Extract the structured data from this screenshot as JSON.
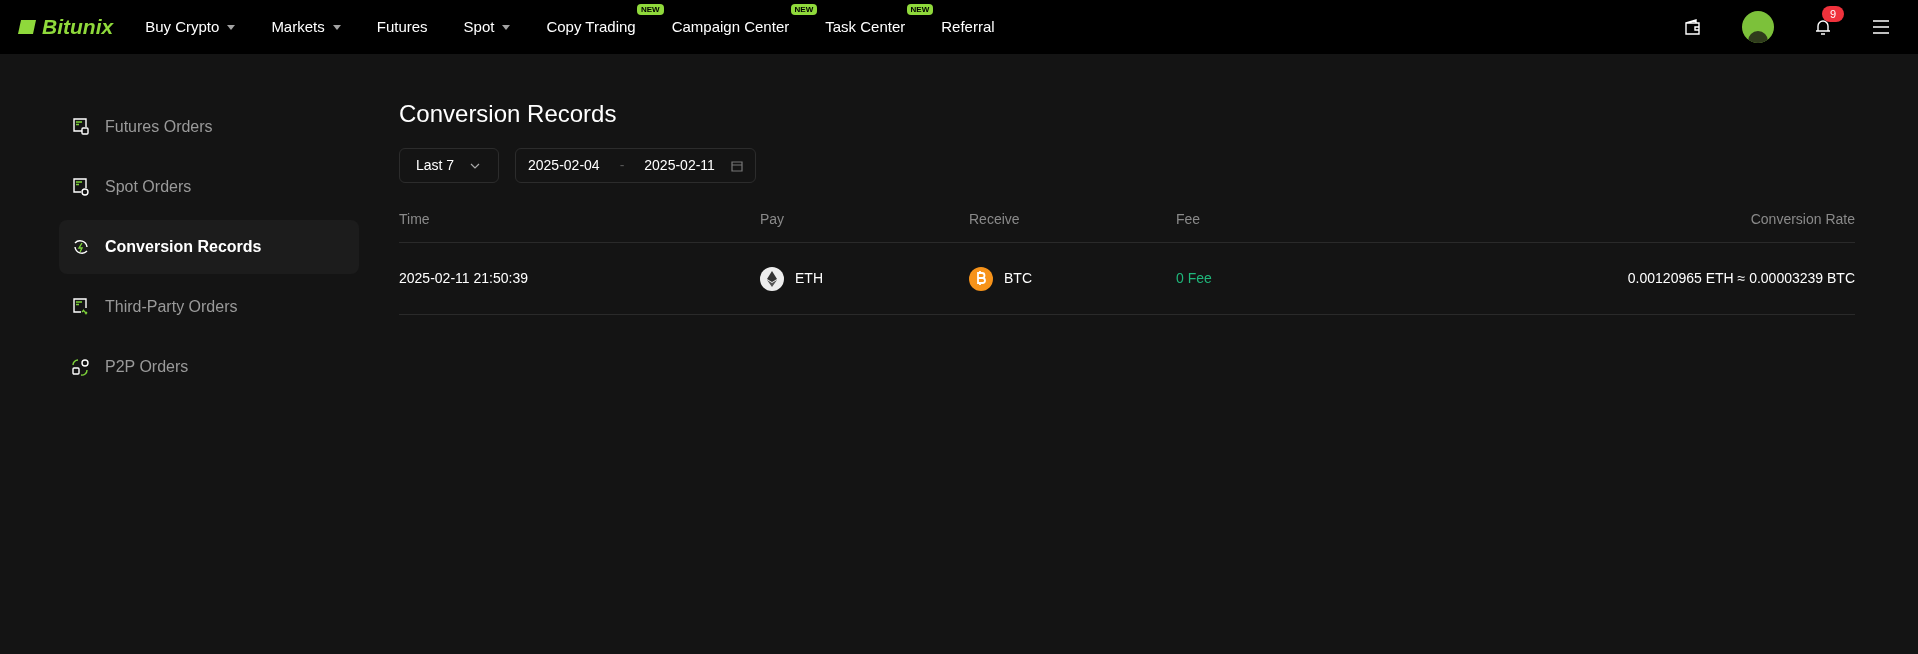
{
  "logo": {
    "text": "Bitunix"
  },
  "nav": [
    {
      "label": "Buy Crypto",
      "dropdown": true
    },
    {
      "label": "Markets",
      "dropdown": true
    },
    {
      "label": "Futures",
      "dropdown": false
    },
    {
      "label": "Spot",
      "dropdown": true
    },
    {
      "label": "Copy Trading",
      "dropdown": false,
      "badge": "NEW"
    },
    {
      "label": "Campaign Center",
      "dropdown": false,
      "badge": "NEW"
    },
    {
      "label": "Task Center",
      "dropdown": false,
      "badge": "NEW"
    },
    {
      "label": "Referral",
      "dropdown": false
    }
  ],
  "notifications": {
    "count": "9"
  },
  "sidebar": {
    "items": [
      {
        "label": "Futures Orders",
        "selected": false
      },
      {
        "label": "Spot Orders",
        "selected": false
      },
      {
        "label": "Conversion Records",
        "selected": true
      },
      {
        "label": "Third-Party Orders",
        "selected": false
      },
      {
        "label": "P2P Orders",
        "selected": false
      }
    ]
  },
  "page": {
    "title": "Conversion Records"
  },
  "filters": {
    "period": "Last 7",
    "date_start": "2025-02-04",
    "date_separator": "-",
    "date_end": "2025-02-11"
  },
  "table": {
    "columns": [
      "Time",
      "Pay",
      "Receive",
      "Fee",
      "Conversion Rate"
    ],
    "rows": [
      {
        "time": "2025-02-11 21:50:39",
        "pay": {
          "coin": "ETH",
          "kind": "eth"
        },
        "receive": {
          "coin": "BTC",
          "kind": "btc"
        },
        "fee": "0 Fee",
        "rate": "0.00120965 ETH ≈ 0.00003239 BTC"
      }
    ]
  }
}
